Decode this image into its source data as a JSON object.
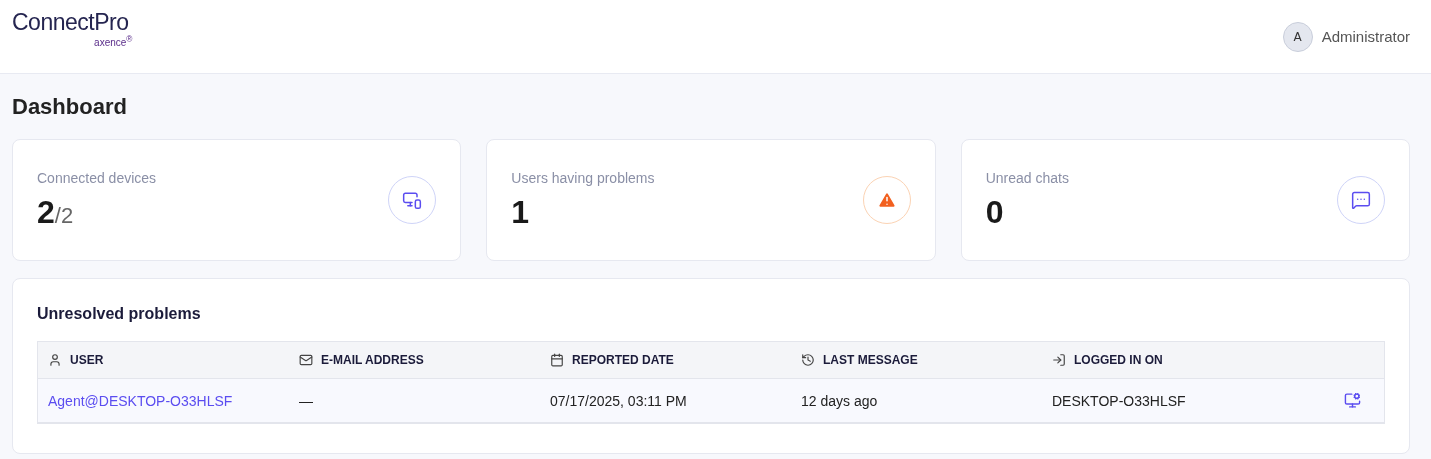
{
  "header": {
    "logo": {
      "name": "ConnectPro",
      "brand": "axence",
      "mark": "®"
    },
    "user": {
      "initial": "A",
      "name": "Administrator"
    }
  },
  "page_title": "Dashboard",
  "stats": [
    {
      "kind": "devices",
      "label": "Connected devices",
      "value": "2",
      "total": "/2"
    },
    {
      "kind": "warning",
      "label": "Users having problems",
      "value": "1"
    },
    {
      "kind": "chat",
      "label": "Unread chats",
      "value": "0"
    }
  ],
  "problems": {
    "title": "Unresolved problems",
    "columns": [
      {
        "kind": "user",
        "label": "USER"
      },
      {
        "kind": "mail",
        "label": "E-MAIL ADDRESS"
      },
      {
        "kind": "calendar",
        "label": "REPORTED DATE"
      },
      {
        "kind": "history",
        "label": "LAST MESSAGE"
      },
      {
        "kind": "login",
        "label": "LOGGED IN ON"
      }
    ],
    "rows": [
      {
        "user": "Agent@DESKTOP-O33HLSF",
        "email": "—",
        "reported": "07/17/2025, 03:11 PM",
        "last_message": "12 days ago",
        "logged_in_on": "DESKTOP-O33HLSF"
      }
    ]
  }
}
